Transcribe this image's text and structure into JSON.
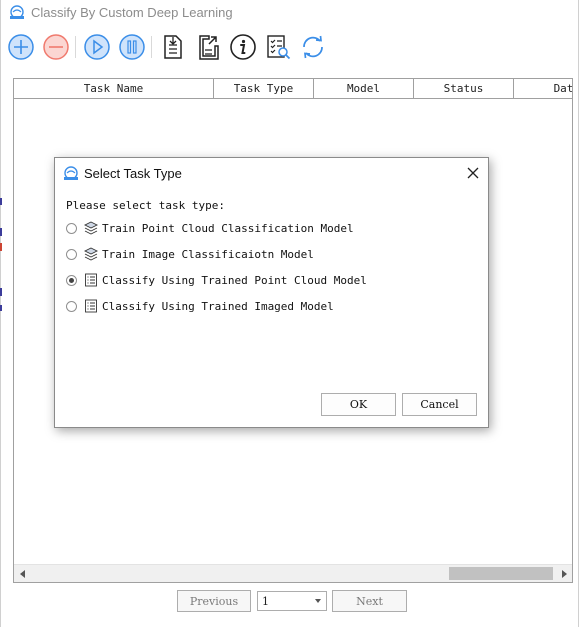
{
  "window": {
    "title": "Classify By Custom Deep Learning"
  },
  "toolbar": {
    "buttons": [
      {
        "name": "add-icon",
        "color": "#3b8ee8"
      },
      {
        "name": "remove-icon",
        "color": "#f07a6e"
      },
      {
        "name": "play-icon",
        "color": "#3b8ee8"
      },
      {
        "name": "pause-icon",
        "color": "#3b8ee8"
      },
      {
        "name": "export-report-icon",
        "color": "#222222"
      },
      {
        "name": "export-file-icon",
        "color": "#222222"
      },
      {
        "name": "info-icon",
        "color": "#222222"
      },
      {
        "name": "task-list-search-icon",
        "color": "#222222"
      },
      {
        "name": "refresh-icon",
        "color": "#3b8ee8"
      }
    ]
  },
  "table": {
    "columns": [
      "Task Name",
      "Task Type",
      "Model",
      "Status",
      "Dat"
    ]
  },
  "pager": {
    "previous_label": "Previous",
    "page_value": "1",
    "next_label": "Next"
  },
  "dialog": {
    "title": "Select Task Type",
    "prompt": "Please select task type:",
    "options": [
      {
        "label": "Train Point Cloud Classification Model",
        "icon": "layers-icon",
        "checked": false
      },
      {
        "label": "Train Image Classificaiotn Model",
        "icon": "layers-icon",
        "checked": false
      },
      {
        "label": "Classify Using Trained Point Cloud Model",
        "icon": "list-document-icon",
        "checked": true
      },
      {
        "label": "Classify Using Trained Imaged Model",
        "icon": "list-document-icon",
        "checked": false
      }
    ],
    "ok_label": "OK",
    "cancel_label": "Cancel"
  }
}
